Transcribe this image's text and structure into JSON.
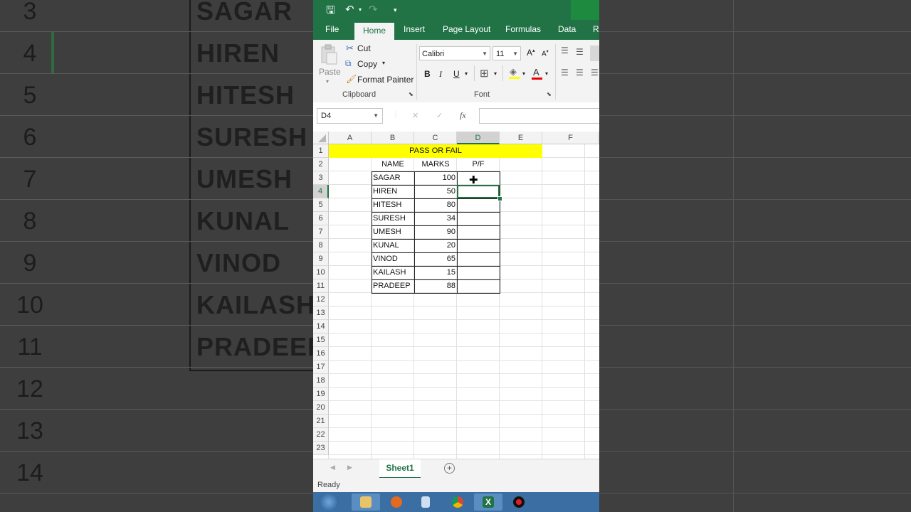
{
  "background": {
    "rows": [
      {
        "num": "3",
        "name": "SAGAR"
      },
      {
        "num": "4",
        "name": "HIREN"
      },
      {
        "num": "5",
        "name": "HITESH"
      },
      {
        "num": "6",
        "name": "SURESH"
      },
      {
        "num": "7",
        "name": "UMESH"
      },
      {
        "num": "8",
        "name": "KUNAL"
      },
      {
        "num": "9",
        "name": "VINOD"
      },
      {
        "num": "10",
        "name": "KAILASH"
      },
      {
        "num": "11",
        "name": "PRADEEP"
      },
      {
        "num": "12",
        "name": ""
      },
      {
        "num": "13",
        "name": ""
      },
      {
        "num": "14",
        "name": ""
      }
    ]
  },
  "ribbon": {
    "tabs": [
      "File",
      "Home",
      "Insert",
      "Page Layout",
      "Formulas",
      "Data",
      "Re"
    ],
    "active_tab": "Home",
    "clipboard": {
      "paste": "Paste",
      "cut": "Cut",
      "copy": "Copy",
      "format_painter": "Format Painter",
      "group_label": "Clipboard"
    },
    "font": {
      "family": "Calibri",
      "size": "11",
      "bold": "B",
      "italic": "I",
      "underline": "U",
      "group_label": "Font"
    }
  },
  "formula_bar": {
    "name_box": "D4",
    "fx": "fx",
    "cancel": "✕",
    "enter": "✓",
    "content": ""
  },
  "grid": {
    "columns": [
      "A",
      "B",
      "C",
      "D",
      "E",
      "F"
    ],
    "selected_column": "D",
    "rows": [
      "1",
      "2",
      "3",
      "4",
      "5",
      "6",
      "7",
      "8",
      "9",
      "10",
      "11",
      "12",
      "13",
      "14",
      "15",
      "16",
      "17",
      "18",
      "19",
      "20",
      "21",
      "22",
      "23"
    ],
    "selected_row": "4",
    "title": "PASS OR FAIL",
    "headers": {
      "name": "NAME",
      "marks": "MARKS",
      "pf": "P/F"
    },
    "records": [
      {
        "name": "SAGAR",
        "marks": "100"
      },
      {
        "name": "HIREN",
        "marks": "50"
      },
      {
        "name": "HITESH",
        "marks": "80"
      },
      {
        "name": "SURESH",
        "marks": "34"
      },
      {
        "name": "UMESH",
        "marks": "90"
      },
      {
        "name": "KUNAL",
        "marks": "20"
      },
      {
        "name": "VINOD",
        "marks": "65"
      },
      {
        "name": "KAILASH",
        "marks": "15"
      },
      {
        "name": "PRADEEP",
        "marks": "88"
      }
    ]
  },
  "sheets": {
    "active": "Sheet1",
    "add": "+"
  },
  "status": {
    "text": "Ready"
  },
  "colors": {
    "excel_green": "#217346",
    "title_fill": "#ffff00"
  }
}
